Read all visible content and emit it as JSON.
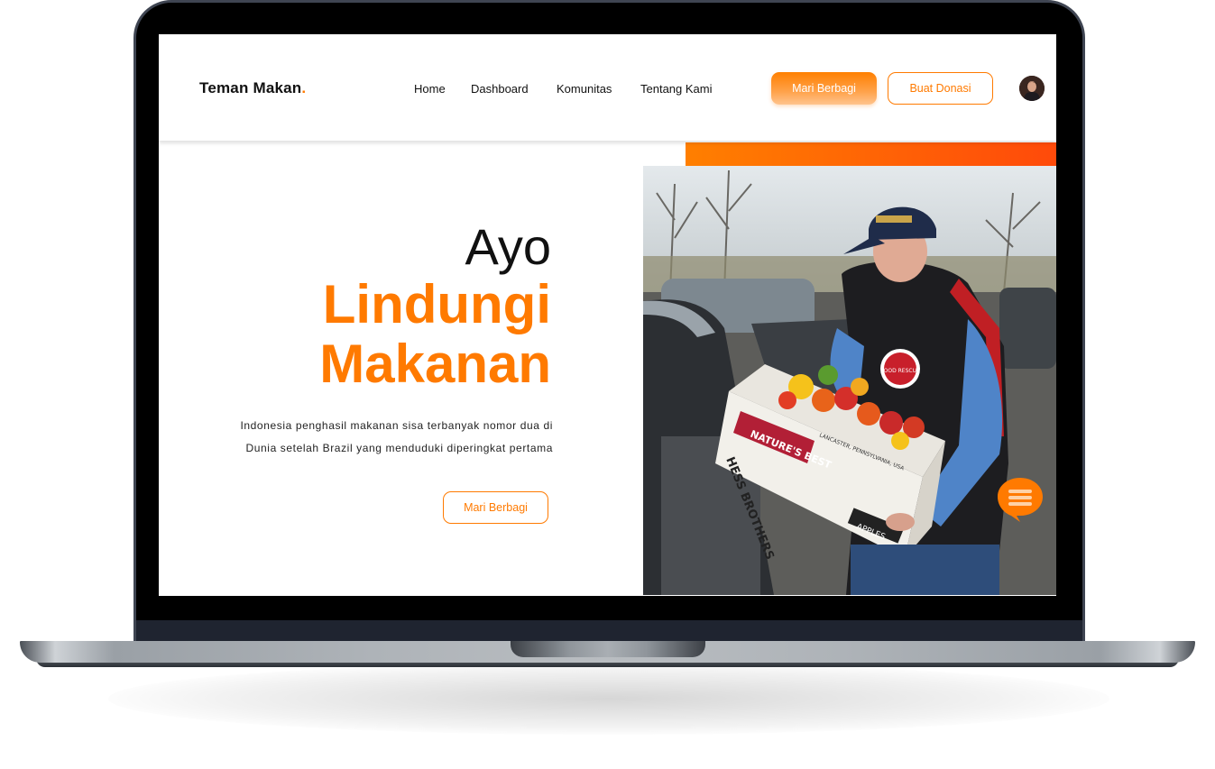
{
  "brand": {
    "name": "Teman Makan",
    "dot": ".",
    "accent": "#ff7a00"
  },
  "nav": {
    "links": [
      "Home",
      "Dashboard",
      "Komunitas",
      "Tentang Kami"
    ],
    "primary_button": "Mari Berbagi",
    "outline_button": "Buat Donasi"
  },
  "hero": {
    "line1": "Ayo",
    "line2": "Lindungi",
    "line3": "Makanan",
    "description": "Indonesia penghasil makanan sisa terbanyak nomor dua di Dunia setelah Brazil yang menduduki diperingkat pertama",
    "button": "Mari Berbagi"
  },
  "photo": {
    "box_text": [
      "HESS BROTHERS",
      "NATURE'S BEST",
      "LANCASTER, PENNSYLVANIA, USA",
      "APPLES"
    ],
    "badge_text": "FOOD RESCUE"
  },
  "icons": {
    "avatar": "user-avatar",
    "chat": "chat-bubble-icon"
  }
}
